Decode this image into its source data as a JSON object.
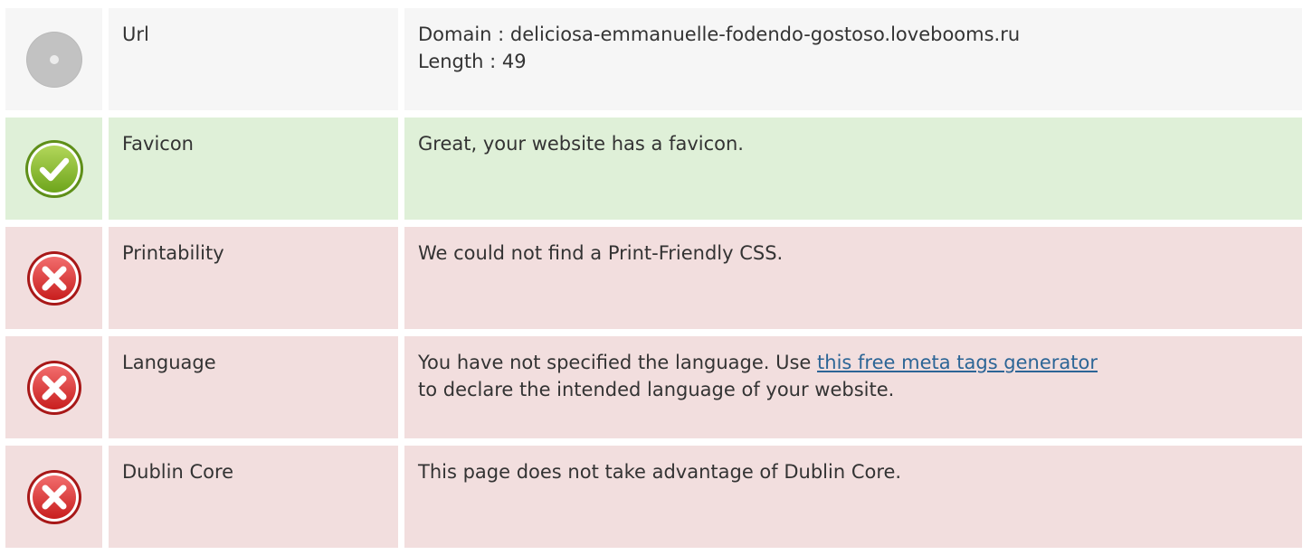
{
  "rows": [
    {
      "status": "neutral",
      "icon": "info-circle-icon",
      "label": "Url",
      "lines": [
        "Domain : deliciosa-emmanuelle-fodendo-gostoso.lovebooms.ru",
        "Length : 49"
      ]
    },
    {
      "status": "good",
      "icon": "check-circle-icon",
      "label": "Favicon",
      "lines": [
        "Great, your website has a favicon."
      ]
    },
    {
      "status": "bad",
      "icon": "error-circle-icon",
      "label": "Printability",
      "lines": [
        "We could not find a Print-Friendly CSS."
      ]
    },
    {
      "status": "bad",
      "icon": "error-circle-icon",
      "label": "Language",
      "text_before_link": "You have not specified the language. Use ",
      "link_text": "this free meta tags generator",
      "text_after_link": "to declare the intended language of your website."
    },
    {
      "status": "bad",
      "icon": "error-circle-icon",
      "label": "Dublin Core",
      "lines": [
        "This page does not take advantage of Dublin Core."
      ]
    }
  ],
  "colors": {
    "neutral_bg": "#f6f6f6",
    "good_bg": "#dff0d8",
    "bad_bg": "#f2dede",
    "link": "#2c6596",
    "text": "#333333"
  }
}
